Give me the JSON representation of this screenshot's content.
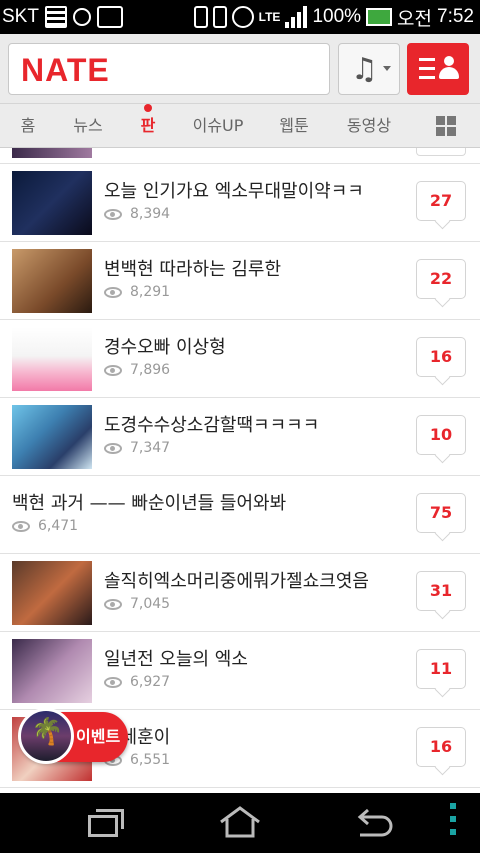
{
  "status_bar": {
    "carrier": "SKT",
    "network": "LTE",
    "battery": "100%",
    "ampm": "오전",
    "time": "7:52"
  },
  "header": {
    "logo_text": "NATE",
    "music_icon": "music-note-icon",
    "menu_icon": "my-menu-icon",
    "accent_color": "#e8262c"
  },
  "tabs": [
    {
      "label": "홈",
      "active": false
    },
    {
      "label": "뉴스",
      "active": false
    },
    {
      "label": "판",
      "active": true
    },
    {
      "label": "이슈UP",
      "active": false
    },
    {
      "label": "웹툰",
      "active": false
    },
    {
      "label": "동영상",
      "active": false
    }
  ],
  "list": {
    "items": [
      {
        "title": "오늘 인기가요 엑소무대말이약ㅋㅋ",
        "views": "8,394",
        "comments": "27",
        "has_thumb": true
      },
      {
        "title": "변백현 따라하는 김루한",
        "views": "8,291",
        "comments": "22",
        "has_thumb": true
      },
      {
        "title": "경수오빠 이상형",
        "views": "7,896",
        "comments": "16",
        "has_thumb": true
      },
      {
        "title": "도경수수상소감할땍ㅋㅋㅋㅋ",
        "views": "7,347",
        "comments": "10",
        "has_thumb": true
      },
      {
        "title": "백현 과거 —— 빠순이년들 들어와봐",
        "views": "6,471",
        "comments": "75",
        "has_thumb": false
      },
      {
        "title": "솔직히엑소머리중에뭐가젤쇼크엿음",
        "views": "7,045",
        "comments": "31",
        "has_thumb": true
      },
      {
        "title": "일년전 오늘의 엑소",
        "views": "6,927",
        "comments": "11",
        "has_thumb": true
      },
      {
        "title": "내세훈이",
        "views": "6,551",
        "comments": "16",
        "has_thumb": true
      }
    ]
  },
  "event_button": {
    "label": "이벤트"
  }
}
